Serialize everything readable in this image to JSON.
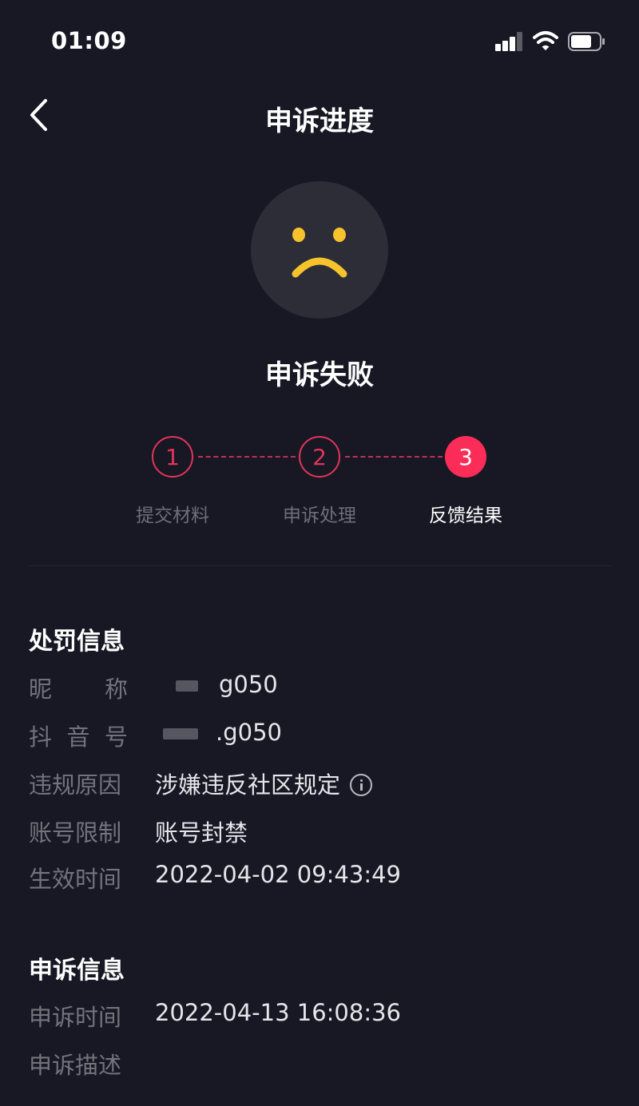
{
  "status_bar": {
    "time": "01:09"
  },
  "nav": {
    "title": "申诉进度"
  },
  "result": {
    "icon": "sad-face-icon",
    "title": "申诉失败"
  },
  "steps": [
    {
      "number": "1",
      "label": "提交材料",
      "state": "done"
    },
    {
      "number": "2",
      "label": "申诉处理",
      "state": "done"
    },
    {
      "number": "3",
      "label": "反馈结果",
      "state": "current"
    }
  ],
  "penalty": {
    "title": "处罚信息",
    "nickname": {
      "label_chars": [
        "昵",
        "称"
      ],
      "value": "g050"
    },
    "douyin_id": {
      "label_chars": [
        "抖",
        "音",
        "号"
      ],
      "value": ".g050"
    },
    "reason": {
      "label": "违规原因",
      "value": "涉嫌违反社区规定"
    },
    "restriction": {
      "label": "账号限制",
      "value": "账号封禁"
    },
    "effective_time": {
      "label": "生效时间",
      "value": "2022-04-02 09:43:49"
    }
  },
  "appeal": {
    "title": "申诉信息",
    "time": {
      "label": "申诉时间",
      "value": "2022-04-13 16:08:36"
    },
    "description": {
      "label": "申诉描述"
    }
  },
  "colors": {
    "background": "#171823",
    "accent": "#fb2d58",
    "face": "#f6c32d"
  }
}
